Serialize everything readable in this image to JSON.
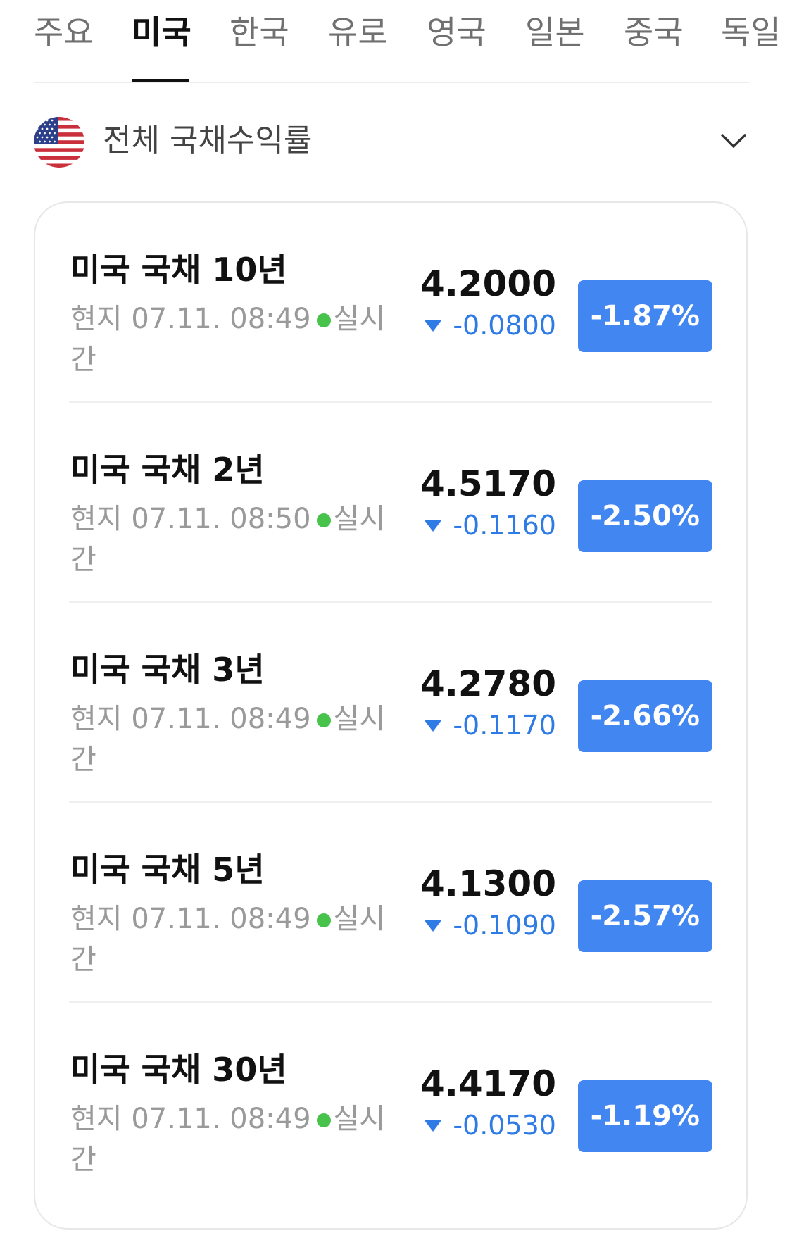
{
  "tabs": [
    "주요",
    "미국",
    "한국",
    "유로",
    "영국",
    "일본",
    "중국",
    "독일"
  ],
  "active_tab": "미국",
  "region": {
    "title": "전체 국채수익률",
    "flag": "us-flag-icon",
    "expand_icon": "chevron-down-icon"
  },
  "colors": {
    "accent_blue": "#4286f2",
    "change_blue": "#2f7be5",
    "live_green": "#47c24a"
  },
  "bonds": [
    {
      "name": "미국 국채 10년",
      "time": "현지 07.11. 08:49",
      "status": "실시간",
      "price": "4.2000",
      "change": "-0.0800",
      "pct": "-1.87%"
    },
    {
      "name": "미국 국채 2년",
      "time": "현지 07.11. 08:50",
      "status": "실시간",
      "price": "4.5170",
      "change": "-0.1160",
      "pct": "-2.50%"
    },
    {
      "name": "미국 국채 3년",
      "time": "현지 07.11. 08:49",
      "status": "실시간",
      "price": "4.2780",
      "change": "-0.1170",
      "pct": "-2.66%"
    },
    {
      "name": "미국 국채 5년",
      "time": "현지 07.11. 08:49",
      "status": "실시간",
      "price": "4.1300",
      "change": "-0.1090",
      "pct": "-2.57%"
    },
    {
      "name": "미국 국채 30년",
      "time": "현지 07.11. 08:49",
      "status": "실시간",
      "price": "4.4170",
      "change": "-0.0530",
      "pct": "-1.19%"
    }
  ]
}
